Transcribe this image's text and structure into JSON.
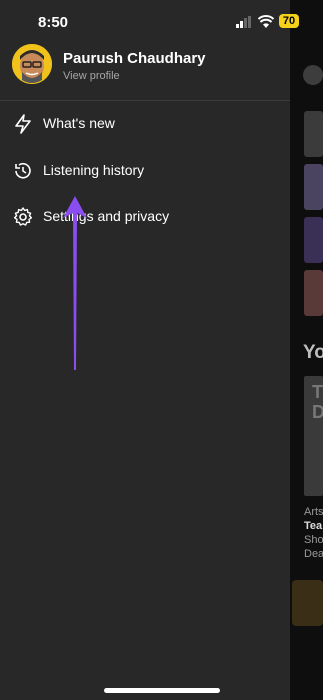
{
  "status_bar": {
    "time": "8:50",
    "battery": "70"
  },
  "profile": {
    "name": "Paurush Chaudhary",
    "subtitle": "View profile"
  },
  "menu": [
    {
      "label": "What's new",
      "icon": "lightning-icon"
    },
    {
      "label": "Listening history",
      "icon": "history-icon"
    },
    {
      "label": "Settings and privacy",
      "icon": "gear-icon"
    }
  ],
  "background_app": {
    "heading": "Yo",
    "card_text": [
      "Arts",
      "Tea",
      "Sho",
      "Dea"
    ]
  },
  "colors": {
    "drawer": "#282828",
    "arrow": "#8a4ef0",
    "battery": "#f3d219"
  }
}
